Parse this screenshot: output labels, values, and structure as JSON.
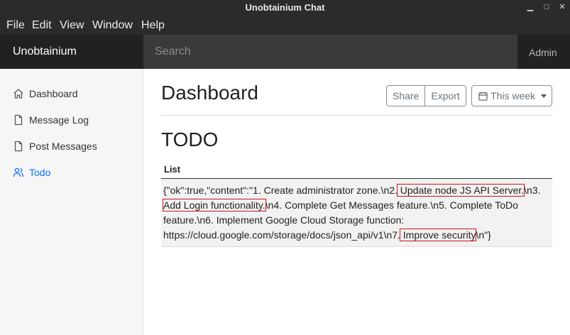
{
  "window": {
    "title": "Unobtainium Chat",
    "controls": {
      "minimize": "▁",
      "maximize": "□",
      "close": "✕"
    }
  },
  "menubar": {
    "items": [
      "File",
      "Edit",
      "View",
      "Window",
      "Help"
    ]
  },
  "navbar": {
    "brand": "Unobtainium",
    "search_placeholder": "Search",
    "user": "Admin"
  },
  "sidebar": {
    "items": [
      {
        "label": "Dashboard",
        "icon": "home-icon",
        "active": false
      },
      {
        "label": "Message Log",
        "icon": "file-icon",
        "active": false
      },
      {
        "label": "Post Messages",
        "icon": "file-icon",
        "active": false
      },
      {
        "label": "Todo",
        "icon": "users-icon",
        "active": true
      }
    ],
    "active_color": "#0d6efd"
  },
  "main": {
    "title": "Dashboard",
    "toolbar": {
      "share": "Share",
      "export": "Export",
      "range": "This week"
    },
    "section_title": "TODO",
    "table": {
      "header": "List",
      "segments": [
        {
          "text": "{\"ok\":true,\"content\":\"1. Create administrator zone.\\n2.",
          "highlight": false
        },
        {
          "text": " Update node JS API Server.",
          "highlight": true
        },
        {
          "text": "\\n3. ",
          "highlight": false
        },
        {
          "text": "Add Login functionality.",
          "highlight": true
        },
        {
          "text": "\\n4. Complete Get Messages feature.\\n5. Complete ToDo feature.\\n6. Implement Google Cloud Storage function: https://cloud.google.com/storage/docs/json_api/v1\\n7.",
          "highlight": false
        },
        {
          "text": " Improve security",
          "highlight": true
        },
        {
          "text": "\\n\"}",
          "highlight": false
        }
      ]
    },
    "highlight_color": "#d0121b"
  }
}
